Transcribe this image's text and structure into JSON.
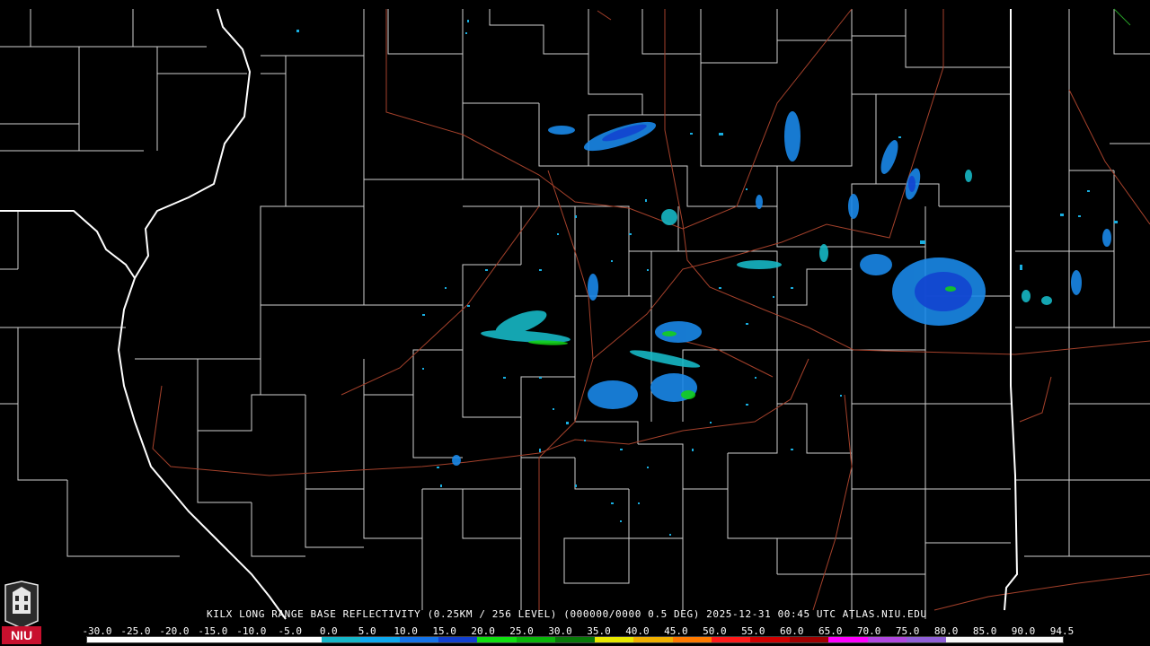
{
  "product": {
    "caption": "KILX LONG RANGE BASE REFLECTIVITY (0.25KM / 256 LEVEL) (000000/0000 0.5 DEG) 2025-12-31 00:45 UTC  ATLAS.NIU.EDU"
  },
  "logo": {
    "text": "NIU",
    "name": "niu-logo"
  },
  "colorbar": {
    "tick_labels": [
      "-30.0",
      "-25.0",
      "-20.0",
      "-15.0",
      "-10.0",
      "-5.0",
      "0.0",
      "5.0",
      "10.0",
      "15.0",
      "20.0",
      "25.0",
      "30.0",
      "35.0",
      "40.0",
      "45.0",
      "50.0",
      "55.0",
      "60.0",
      "65.0",
      "70.0",
      "75.0",
      "80.0",
      "85.0",
      "90.0",
      "94.5"
    ],
    "colors": [
      "#ffffff",
      "#ffffff",
      "#ffffff",
      "#ffffff",
      "#ffffff",
      "#ffffff",
      "#16b6c8",
      "#0ea8ee",
      "#1473e8",
      "#1240d0",
      "#10e010",
      "#09b509",
      "#087808",
      "#e8e800",
      "#f0b000",
      "#ff7a00",
      "#ff1a1a",
      "#d00000",
      "#a00000",
      "#ff00ff",
      "#b048e0",
      "#9060d8",
      "#f8f8f8",
      "#f8f8f8",
      "#f8f8f8"
    ]
  },
  "map_colors": {
    "background": "#000000",
    "county_lines": "#d0d0d0",
    "state_lines": "#ffffff",
    "roads": "#a5412b"
  }
}
